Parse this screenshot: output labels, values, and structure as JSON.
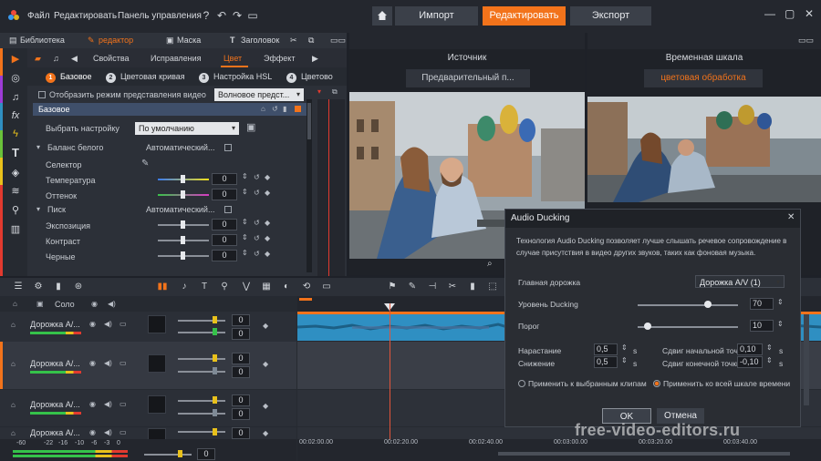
{
  "menu": {
    "file": "Файл",
    "edit": "Редактировать",
    "control_panel": "Панель управления"
  },
  "modes": {
    "import": "Импорт",
    "edit": "Редактировать",
    "export": "Экспорт"
  },
  "library_bar": {
    "library": "Библиотека",
    "editor": "редактор",
    "mask": "Маска",
    "title": "Заголовок"
  },
  "editor": {
    "tabs": [
      "Свойства",
      "Исправления",
      "Цвет",
      "Эффект"
    ],
    "subtabs": [
      {
        "num": "1",
        "label": "Базовое"
      },
      {
        "num": "2",
        "label": "Цветовая кривая"
      },
      {
        "num": "3",
        "label": "Настройка HSL"
      },
      {
        "num": "4",
        "label": "Цветово"
      }
    ],
    "show_video_mode": "Отобразить режим представления видео",
    "view_mode_value": "Волновое предст...",
    "section_title": "Базовое",
    "preset_label": "Выбрать настройку",
    "preset_value": "По умолчанию",
    "white_balance": "Баланс белого",
    "wb_auto": "Автоматический...",
    "selector": "Селектор",
    "temperature": "Температура",
    "temperature_value": "0",
    "tint": "Оттенок",
    "tint_value": "0",
    "peak": "Писк",
    "peak_auto": "Автоматический...",
    "exposure": "Экспозиция",
    "exposure_value": "0",
    "contrast": "Контраст",
    "contrast_value": "0",
    "blacks": "Черные",
    "blacks_value": "0"
  },
  "preview_source": {
    "title": "Источник",
    "subtitle": "Предварительный п..."
  },
  "preview_timeline": {
    "title": "Временная шкала",
    "subtitle": "цветовая обработка"
  },
  "timeline": {
    "solo": "Соло",
    "tracks": [
      {
        "name": "Дорожка А/...",
        "v1": "0",
        "v2": "0"
      },
      {
        "name": "Дорожка А/...",
        "v1": "0",
        "v2": "0"
      },
      {
        "name": "Дорожка А/...",
        "v1": "0",
        "v2": "0"
      },
      {
        "name": "Дорожка А/...",
        "v1": "0",
        "v2": "0"
      }
    ],
    "ruler": [
      "00:02:00.00",
      "00:02:20.00",
      "00:02:40.00",
      "00:03:00.00",
      "00:03:20.00",
      "00:03:40.00"
    ],
    "vu_scale": [
      "-60",
      "-22",
      "-16",
      "-10",
      "-6",
      "-3",
      "0"
    ],
    "master_value": "0"
  },
  "dialog": {
    "title": "Audio Ducking",
    "description": "Технология Audio Ducking позволяет лучше слышать речевое сопровождение в случае присутствия в видео других звуков, таких как фоновая музыка.",
    "main_track_label": "Главная дорожка",
    "main_track_value": "Дорожка A/V (1)",
    "ducking_level_label": "Уровень Ducking",
    "ducking_level_value": "70",
    "ducking_level_fraction": 0.7,
    "threshold_label": "Порог",
    "threshold_value": "10",
    "threshold_fraction": 0.1,
    "attack_label": "Нарастание",
    "attack_value": "0,5",
    "decay_label": "Снижение",
    "decay_value": "0,5",
    "unit_s": "s",
    "start_shift_label": "Сдвиг начальной точки",
    "start_shift_value": "0,10",
    "end_shift_label": "Сдвиг конечной точки",
    "end_shift_value": "-0,10",
    "apply_selected": "Применить к выбранным клипам",
    "apply_all": "Применить ко всей шкале времени",
    "ok": "OK",
    "cancel": "Отмена"
  },
  "watermark": "free-video-editors.ru",
  "colors": {
    "accent": "#f2731b",
    "panel": "#2a2e36",
    "clip_blue": "#2f8fc2"
  }
}
